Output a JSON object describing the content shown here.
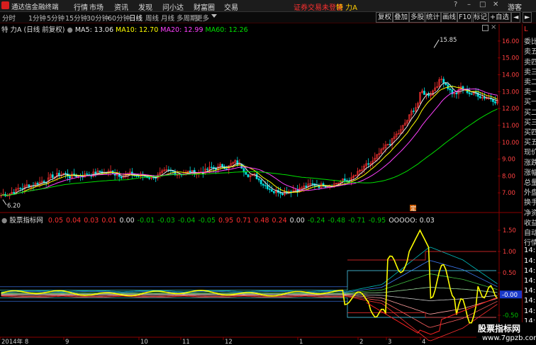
{
  "app": {
    "name": "通达信金融终端",
    "menu": [
      "行情",
      "市场",
      "资讯",
      "发现",
      "问小达",
      "财富圈",
      "交易"
    ],
    "alert": "证券交易未登录",
    "stock_title": "特 力A",
    "guest": "游客",
    "window_buttons": [
      "?",
      "–",
      "□",
      "✕"
    ]
  },
  "periods": [
    "分时",
    "1分钟",
    "5分钟",
    "15分钟",
    "30分钟",
    "60分钟",
    "日线",
    "周线",
    "月线",
    "多周期",
    "更多"
  ],
  "active_period": "日线",
  "tools": [
    "复权",
    "叠加",
    "多股",
    "统计",
    "画线",
    "F10",
    "标记",
    "+自选",
    "◄",
    "►"
  ],
  "main_legend": {
    "title": "特 力A (日线 前复权)",
    "ma": [
      {
        "label": "MA5: 13.06",
        "color": "#e6e6e6"
      },
      {
        "label": "MA10: 12.70",
        "color": "#ffff00"
      },
      {
        "label": "MA20: 12.99",
        "color": "#ff40ff"
      },
      {
        "label": "MA60: 12.26",
        "color": "#00e000"
      }
    ]
  },
  "indicator_legend": {
    "title": "股票指标网",
    "values": [
      {
        "label": "0.05",
        "color": "#ff3030"
      },
      {
        "label": "0.04",
        "color": "#ff3030"
      },
      {
        "label": "0.03",
        "color": "#ff3030"
      },
      {
        "label": "0.01",
        "color": "#ff3030"
      },
      {
        "label": "0.00",
        "color": "#e0e0e0"
      },
      {
        "label": "-0.01",
        "color": "#00c000"
      },
      {
        "label": "-0.03",
        "color": "#00c000"
      },
      {
        "label": "-0.04",
        "color": "#00c000"
      },
      {
        "label": "-0.05",
        "color": "#00c000"
      },
      {
        "label": "0.95",
        "color": "#ff3030"
      },
      {
        "label": "0.71",
        "color": "#ff3030"
      },
      {
        "label": "0.48",
        "color": "#ff3030"
      },
      {
        "label": "0.24",
        "color": "#ff3030"
      },
      {
        "label": "0.00",
        "color": "#e0e0e0"
      },
      {
        "label": "-0.24",
        "color": "#00c000"
      },
      {
        "label": "-0.48",
        "color": "#00c000"
      },
      {
        "label": "-0.71",
        "color": "#00c000"
      },
      {
        "label": "-0.95",
        "color": "#00c000"
      },
      {
        "label": "OOOOO: 0.03",
        "color": "#e0e0e0"
      }
    ]
  },
  "price_axis": [
    "16.00",
    "15.00",
    "14.00",
    "13.00",
    "12.00",
    "11.00",
    "10.00",
    "9.00",
    "8.00",
    "7.00"
  ],
  "indicator_axis": [
    "1.50",
    "1.00",
    "0.50",
    "0.00",
    "-0.50"
  ],
  "current_indicator_value": "-0.00",
  "low_label": "6.20",
  "high_label": "15.85",
  "marker_label": "定",
  "right_panel": [
    "L",
    "委比",
    "卖五",
    "卖四",
    "卖三",
    "卖二",
    "卖一",
    "买一",
    "买二",
    "买三",
    "买四",
    "买五",
    "现价",
    "涨跌",
    "涨幅",
    "总量",
    "外盘",
    "换手",
    "净资",
    "收益",
    "自动",
    "行情",
    "14:59",
    "14:59",
    "14:59",
    "14:59",
    "14:59",
    "14:59",
    "14:59",
    "14:59"
  ],
  "x_axis": [
    {
      "label": "2014年 8"
    },
    {
      "label": "9"
    },
    {
      "label": "10"
    },
    {
      "label": "11"
    },
    {
      "label": "12"
    },
    {
      "label": "1"
    },
    {
      "label": "2"
    },
    {
      "label": "3"
    },
    {
      "label": "4"
    }
  ],
  "watermark": {
    "line1": "股票指标网",
    "line2": "www.7gpzb.com"
  },
  "colors": {
    "up": "#ff3232",
    "down": "#00e0e0",
    "ma5": "#e6e6e6",
    "ma10": "#ffff00",
    "ma20": "#ff40ff",
    "ma60": "#00e000",
    "frame": "#8b0000"
  }
}
